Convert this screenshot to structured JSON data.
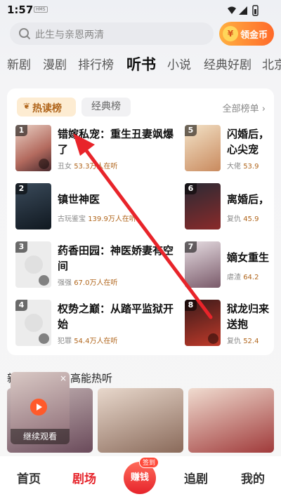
{
  "status": {
    "time": "1:57",
    "badge": "HMS"
  },
  "search": {
    "placeholder": "此生与亲恩两清",
    "coin_label": "领金币",
    "coin_icon": "¥"
  },
  "tabs": [
    "新剧",
    "漫剧",
    "排行榜",
    "听书",
    "小说",
    "经典好剧",
    "北京"
  ],
  "active_tab": "听书",
  "ranking": {
    "chip_hot": "热读榜",
    "chip_classic": "经典榜",
    "all_list": "全部榜单 ›",
    "left": [
      {
        "rank": "1",
        "title": "错嫁私宠：重生丑妻飒爆了",
        "tag": "丑女",
        "listeners": "53.3万人在听"
      },
      {
        "rank": "2",
        "title": "镇世神医",
        "tag": "古玩鉴宝",
        "listeners": "139.9万人在听"
      },
      {
        "rank": "3",
        "title": "药香田园：神医娇妻有空间",
        "tag": "强强",
        "listeners": "67.0万人在听"
      },
      {
        "rank": "4",
        "title": "权势之巅：从踏平监狱开始",
        "tag": "犯罪",
        "listeners": "54.4万人在听"
      }
    ],
    "right": [
      {
        "rank": "5",
        "title": "闪婚后，心尖宠",
        "tag": "大佬",
        "listeners": "53.9"
      },
      {
        "rank": "6",
        "title": "离婚后，",
        "tag": "复仇",
        "listeners": "45.9"
      },
      {
        "rank": "7",
        "title": "嫡女重生",
        "tag": "虐渣",
        "listeners": "64.2"
      },
      {
        "rank": "8",
        "title": "狱龙归来送抱",
        "tag": "复仇",
        "listeners": "52.4"
      }
    ]
  },
  "recommend": {
    "title": "新",
    "title_suffix": "高能热听",
    "floating_label": "继续观看",
    "floating_close": "×"
  },
  "bottom_nav": {
    "home": "首页",
    "theater": "剧场",
    "earn": "赚钱",
    "earn_badge": "签到",
    "follow": "追剧",
    "mine": "我的"
  },
  "colors": {
    "accent": "#e6242b",
    "gold": "#b0651b",
    "coin": "#ff6a2a"
  }
}
